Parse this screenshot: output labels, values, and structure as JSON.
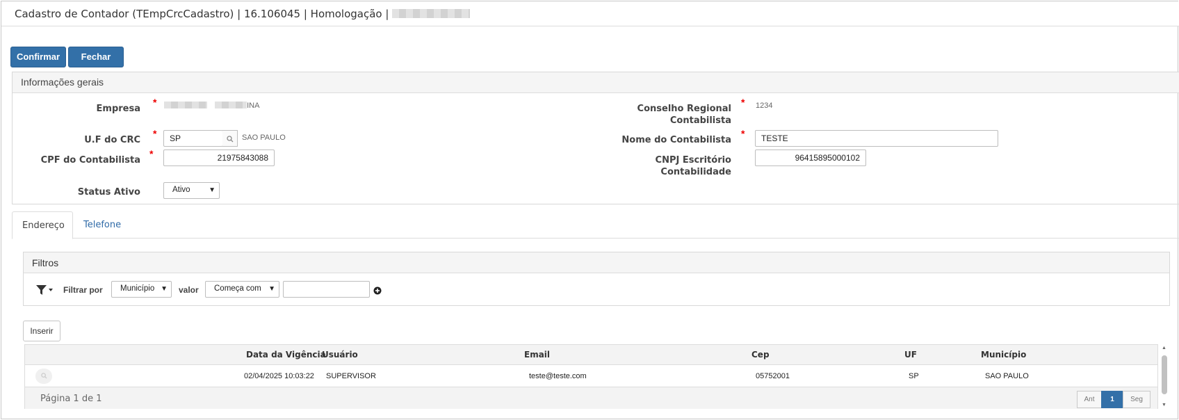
{
  "window": {
    "title": "Cadastro de Contador (TEmpCrcCadastro) | 16.106045 | Homologação |"
  },
  "toolbar": {
    "confirm_label": "Confirmar",
    "close_label": "Fechar"
  },
  "general": {
    "header": "Informações gerais",
    "empresa": {
      "label": "Empresa",
      "value_suffix": "INA"
    },
    "uf_crc": {
      "label": "U.F do CRC",
      "value": "SP",
      "description": "SAO PAULO"
    },
    "cpf": {
      "label": "CPF do Contabilista",
      "value": "21975843088"
    },
    "status": {
      "label": "Status Ativo",
      "value": "Ativo"
    },
    "conselho": {
      "label_line1": "Conselho Regional",
      "label_line2": "Contabilista",
      "value": "1234"
    },
    "nome": {
      "label": "Nome do Contabilista",
      "value": "TESTE"
    },
    "cnpj": {
      "label_line1": "CNPJ Escritório",
      "label_line2": "Contabilidade",
      "value": "96415895000102"
    }
  },
  "tabs": [
    {
      "label": "Endereço",
      "active": true
    },
    {
      "label": "Telefone",
      "active": false
    }
  ],
  "filters": {
    "header": "Filtros",
    "filter_by_label": "Filtrar por",
    "field_value": "Município",
    "value_label": "valor",
    "operator_value": "Começa com",
    "text_value": ""
  },
  "insert_label": "Inserir",
  "grid": {
    "columns": [
      "Data da Vigência",
      "Usuário",
      "Email",
      "Cep",
      "UF",
      "Município"
    ],
    "rows": [
      [
        "02/04/2025 10:03:22",
        "SUPERVISOR",
        "teste@teste.com",
        "05752001",
        "SP",
        "SAO PAULO"
      ]
    ],
    "page_info": "Página 1 de 1",
    "pager": {
      "prev": "Ant",
      "current": "1",
      "next": "Seg"
    }
  },
  "icons": {
    "search": "search-icon",
    "filter": "filter-icon",
    "add": "plus-circle-icon",
    "view": "magnifier-icon"
  },
  "colors": {
    "primary": "#3370a8",
    "required": "#e00000",
    "link": "#2f6aa7"
  }
}
